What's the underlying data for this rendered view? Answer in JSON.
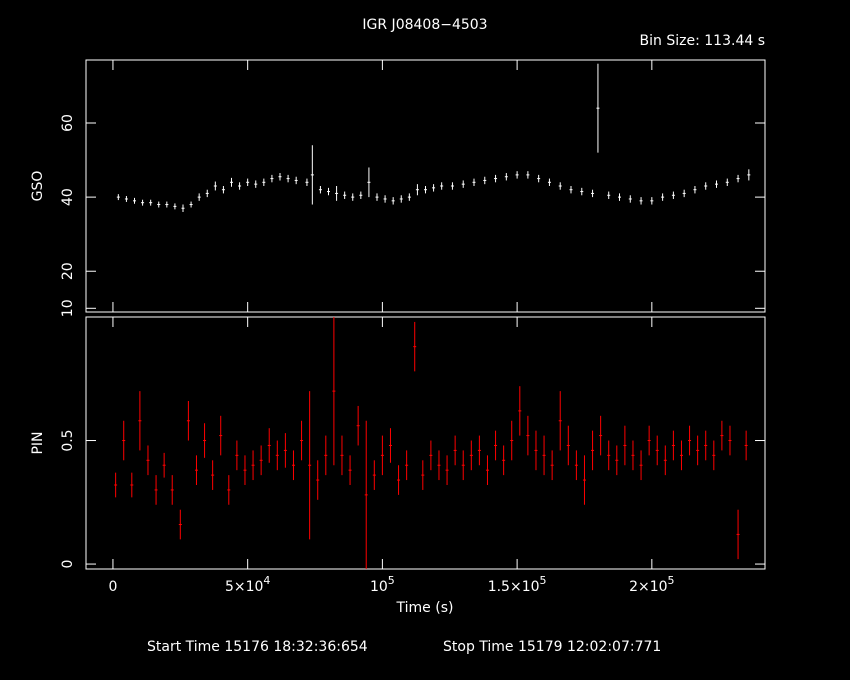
{
  "chart_data": {
    "type": "scatter",
    "title": "IGR J08408−4503",
    "bin_size_label": "Bin Size:  113.44  s",
    "footer": {
      "start": "Start Time 15176 18:32:36:654",
      "stop": "Stop Time 15179 12:02:07:771"
    },
    "xlabel": "Time (s)",
    "xlim": [
      -10000,
      242000
    ],
    "x_ticks": [
      {
        "value": 0,
        "label": "0"
      },
      {
        "value": 50000,
        "label": "5×10",
        "sup": "4"
      },
      {
        "value": 100000,
        "label": "10",
        "sup": "5"
      },
      {
        "value": 150000,
        "label": "1.5×10",
        "sup": "5"
      },
      {
        "value": 200000,
        "label": "2×10",
        "sup": "5"
      }
    ],
    "panels": [
      {
        "ylabel": "GSO",
        "ylim": [
          9,
          77
        ],
        "y_ticks": [
          {
            "value": 10,
            "label": "10"
          },
          {
            "value": 20,
            "label": "20"
          },
          {
            "value": 40,
            "label": "40"
          },
          {
            "value": 60,
            "label": "60"
          }
        ],
        "series": [
          {
            "color": "#ffffff",
            "points": [
              [
                2000,
                40,
                0.8
              ],
              [
                5000,
                39.5,
                0.8
              ],
              [
                8000,
                39,
                0.8
              ],
              [
                11000,
                38.5,
                0.8
              ],
              [
                14000,
                38.5,
                0.8
              ],
              [
                17000,
                38,
                0.8
              ],
              [
                20000,
                38,
                0.8
              ],
              [
                23000,
                37.5,
                0.8
              ],
              [
                26000,
                37,
                1
              ],
              [
                29000,
                38,
                0.8
              ],
              [
                32000,
                40,
                1
              ],
              [
                35000,
                41,
                1
              ],
              [
                38000,
                43,
                1.2
              ],
              [
                41000,
                42,
                1
              ],
              [
                44000,
                44,
                1.2
              ],
              [
                47000,
                43,
                1
              ],
              [
                50000,
                44,
                1
              ],
              [
                53000,
                43.5,
                1
              ],
              [
                56000,
                44,
                1
              ],
              [
                59000,
                45,
                1
              ],
              [
                62000,
                45.5,
                1
              ],
              [
                65000,
                45,
                1
              ],
              [
                68000,
                44.5,
                1
              ],
              [
                72000,
                44,
                1
              ],
              [
                74000,
                46,
                8
              ],
              [
                77000,
                42,
                1
              ],
              [
                80000,
                41.5,
                1
              ],
              [
                83000,
                41,
                2
              ],
              [
                86000,
                40.5,
                1
              ],
              [
                89000,
                40,
                1
              ],
              [
                92000,
                40.5,
                1
              ],
              [
                95000,
                44,
                4
              ],
              [
                98000,
                40,
                1
              ],
              [
                101000,
                39.5,
                1
              ],
              [
                104000,
                39,
                1
              ],
              [
                107000,
                39.5,
                1
              ],
              [
                110000,
                40,
                1
              ],
              [
                113000,
                42,
                1.5
              ],
              [
                116000,
                42,
                1
              ],
              [
                119000,
                42.5,
                1
              ],
              [
                122000,
                43,
                1
              ],
              [
                126000,
                43,
                1
              ],
              [
                130000,
                43.5,
                1
              ],
              [
                134000,
                44,
                1
              ],
              [
                138000,
                44.5,
                1
              ],
              [
                142000,
                45,
                1
              ],
              [
                146000,
                45.5,
                1
              ],
              [
                150000,
                46,
                1
              ],
              [
                154000,
                46,
                1
              ],
              [
                158000,
                45,
                1
              ],
              [
                162000,
                44,
                1
              ],
              [
                166000,
                43,
                1
              ],
              [
                170000,
                42,
                1
              ],
              [
                174000,
                41.5,
                1
              ],
              [
                178000,
                41,
                1
              ],
              [
                180000,
                64,
                12
              ],
              [
                184000,
                40.5,
                1
              ],
              [
                188000,
                40,
                1
              ],
              [
                192000,
                39.5,
                1
              ],
              [
                196000,
                39,
                1
              ],
              [
                200000,
                39,
                1
              ],
              [
                204000,
                40,
                1
              ],
              [
                208000,
                40.5,
                1
              ],
              [
                212000,
                41,
                1
              ],
              [
                216000,
                42,
                1
              ],
              [
                220000,
                43,
                1
              ],
              [
                224000,
                43.5,
                1
              ],
              [
                228000,
                44,
                1
              ],
              [
                232000,
                45,
                1
              ],
              [
                236000,
                46,
                1.5
              ]
            ]
          }
        ]
      },
      {
        "ylabel": "PIN",
        "ylim": [
          -0.02,
          1.0
        ],
        "y_ticks": [
          {
            "value": 0,
            "label": "0"
          },
          {
            "value": 0.5,
            "label": "0.5"
          }
        ],
        "series": [
          {
            "color": "#ff0000",
            "points": [
              [
                1000,
                0.32,
                0.05
              ],
              [
                4000,
                0.5,
                0.08
              ],
              [
                7000,
                0.32,
                0.05
              ],
              [
                10000,
                0.58,
                0.12
              ],
              [
                13000,
                0.42,
                0.06
              ],
              [
                16000,
                0.3,
                0.06
              ],
              [
                19000,
                0.4,
                0.05
              ],
              [
                22000,
                0.3,
                0.06
              ],
              [
                25000,
                0.16,
                0.06
              ],
              [
                28000,
                0.58,
                0.08
              ],
              [
                31000,
                0.38,
                0.06
              ],
              [
                34000,
                0.5,
                0.07
              ],
              [
                37000,
                0.36,
                0.06
              ],
              [
                40000,
                0.52,
                0.08
              ],
              [
                43000,
                0.3,
                0.06
              ],
              [
                46000,
                0.44,
                0.06
              ],
              [
                49000,
                0.38,
                0.06
              ],
              [
                52000,
                0.4,
                0.06
              ],
              [
                55000,
                0.42,
                0.06
              ],
              [
                58000,
                0.48,
                0.07
              ],
              [
                61000,
                0.44,
                0.06
              ],
              [
                64000,
                0.46,
                0.07
              ],
              [
                67000,
                0.4,
                0.06
              ],
              [
                70000,
                0.5,
                0.08
              ],
              [
                73000,
                0.4,
                0.3
              ],
              [
                76000,
                0.34,
                0.08
              ],
              [
                79000,
                0.44,
                0.08
              ],
              [
                82000,
                0.7,
                0.3
              ],
              [
                85000,
                0.44,
                0.08
              ],
              [
                88000,
                0.38,
                0.06
              ],
              [
                91000,
                0.56,
                0.08
              ],
              [
                94000,
                0.28,
                0.3
              ],
              [
                97000,
                0.36,
                0.06
              ],
              [
                100000,
                0.44,
                0.08
              ],
              [
                103000,
                0.48,
                0.07
              ],
              [
                106000,
                0.34,
                0.06
              ],
              [
                109000,
                0.4,
                0.06
              ],
              [
                112000,
                0.88,
                0.1
              ],
              [
                115000,
                0.36,
                0.06
              ],
              [
                118000,
                0.44,
                0.06
              ],
              [
                121000,
                0.4,
                0.06
              ],
              [
                124000,
                0.38,
                0.06
              ],
              [
                127000,
                0.46,
                0.06
              ],
              [
                130000,
                0.4,
                0.06
              ],
              [
                133000,
                0.44,
                0.06
              ],
              [
                136000,
                0.46,
                0.06
              ],
              [
                139000,
                0.38,
                0.06
              ],
              [
                142000,
                0.48,
                0.06
              ],
              [
                145000,
                0.42,
                0.06
              ],
              [
                148000,
                0.5,
                0.08
              ],
              [
                151000,
                0.62,
                0.1
              ],
              [
                154000,
                0.52,
                0.08
              ],
              [
                157000,
                0.46,
                0.08
              ],
              [
                160000,
                0.44,
                0.08
              ],
              [
                163000,
                0.4,
                0.06
              ],
              [
                166000,
                0.58,
                0.12
              ],
              [
                169000,
                0.48,
                0.08
              ],
              [
                172000,
                0.4,
                0.06
              ],
              [
                175000,
                0.34,
                0.1
              ],
              [
                178000,
                0.46,
                0.08
              ],
              [
                181000,
                0.52,
                0.08
              ],
              [
                184000,
                0.44,
                0.06
              ],
              [
                187000,
                0.42,
                0.06
              ],
              [
                190000,
                0.48,
                0.08
              ],
              [
                193000,
                0.44,
                0.06
              ],
              [
                196000,
                0.4,
                0.06
              ],
              [
                199000,
                0.5,
                0.06
              ],
              [
                202000,
                0.46,
                0.06
              ],
              [
                205000,
                0.42,
                0.06
              ],
              [
                208000,
                0.48,
                0.06
              ],
              [
                211000,
                0.44,
                0.06
              ],
              [
                214000,
                0.5,
                0.06
              ],
              [
                217000,
                0.46,
                0.06
              ],
              [
                220000,
                0.48,
                0.06
              ],
              [
                223000,
                0.44,
                0.06
              ],
              [
                226000,
                0.52,
                0.06
              ],
              [
                229000,
                0.5,
                0.06
              ],
              [
                232000,
                0.12,
                0.1
              ],
              [
                235000,
                0.48,
                0.06
              ]
            ]
          }
        ]
      }
    ]
  }
}
